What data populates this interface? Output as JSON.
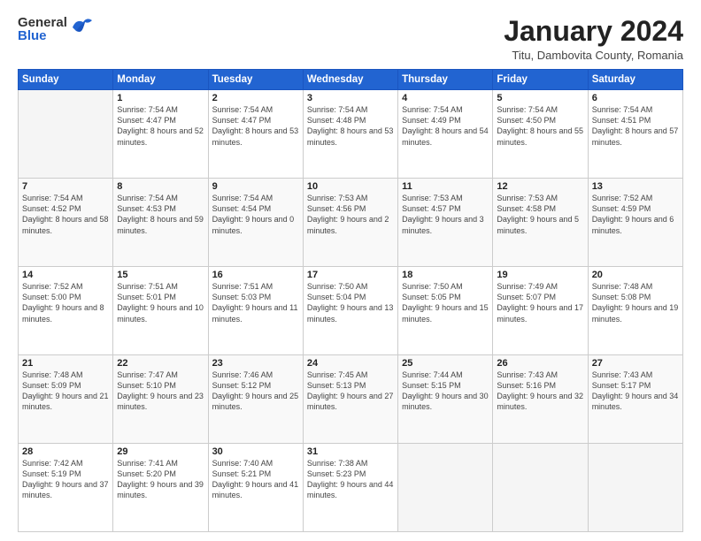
{
  "header": {
    "logo": {
      "general": "General",
      "blue": "Blue"
    },
    "title": "January 2024",
    "location": "Titu, Dambovita County, Romania"
  },
  "calendar": {
    "days": [
      "Sunday",
      "Monday",
      "Tuesday",
      "Wednesday",
      "Thursday",
      "Friday",
      "Saturday"
    ],
    "weeks": [
      [
        {
          "num": "",
          "empty": true
        },
        {
          "num": "1",
          "sunrise": "7:54 AM",
          "sunset": "4:47 PM",
          "daylight": "8 hours and 52 minutes."
        },
        {
          "num": "2",
          "sunrise": "7:54 AM",
          "sunset": "4:47 PM",
          "daylight": "8 hours and 53 minutes."
        },
        {
          "num": "3",
          "sunrise": "7:54 AM",
          "sunset": "4:48 PM",
          "daylight": "8 hours and 53 minutes."
        },
        {
          "num": "4",
          "sunrise": "7:54 AM",
          "sunset": "4:49 PM",
          "daylight": "8 hours and 54 minutes."
        },
        {
          "num": "5",
          "sunrise": "7:54 AM",
          "sunset": "4:50 PM",
          "daylight": "8 hours and 55 minutes."
        },
        {
          "num": "6",
          "sunrise": "7:54 AM",
          "sunset": "4:51 PM",
          "daylight": "8 hours and 57 minutes."
        }
      ],
      [
        {
          "num": "7",
          "sunrise": "7:54 AM",
          "sunset": "4:52 PM",
          "daylight": "8 hours and 58 minutes."
        },
        {
          "num": "8",
          "sunrise": "7:54 AM",
          "sunset": "4:53 PM",
          "daylight": "8 hours and 59 minutes."
        },
        {
          "num": "9",
          "sunrise": "7:54 AM",
          "sunset": "4:54 PM",
          "daylight": "9 hours and 0 minutes."
        },
        {
          "num": "10",
          "sunrise": "7:53 AM",
          "sunset": "4:56 PM",
          "daylight": "9 hours and 2 minutes."
        },
        {
          "num": "11",
          "sunrise": "7:53 AM",
          "sunset": "4:57 PM",
          "daylight": "9 hours and 3 minutes."
        },
        {
          "num": "12",
          "sunrise": "7:53 AM",
          "sunset": "4:58 PM",
          "daylight": "9 hours and 5 minutes."
        },
        {
          "num": "13",
          "sunrise": "7:52 AM",
          "sunset": "4:59 PM",
          "daylight": "9 hours and 6 minutes."
        }
      ],
      [
        {
          "num": "14",
          "sunrise": "7:52 AM",
          "sunset": "5:00 PM",
          "daylight": "9 hours and 8 minutes."
        },
        {
          "num": "15",
          "sunrise": "7:51 AM",
          "sunset": "5:01 PM",
          "daylight": "9 hours and 10 minutes."
        },
        {
          "num": "16",
          "sunrise": "7:51 AM",
          "sunset": "5:03 PM",
          "daylight": "9 hours and 11 minutes."
        },
        {
          "num": "17",
          "sunrise": "7:50 AM",
          "sunset": "5:04 PM",
          "daylight": "9 hours and 13 minutes."
        },
        {
          "num": "18",
          "sunrise": "7:50 AM",
          "sunset": "5:05 PM",
          "daylight": "9 hours and 15 minutes."
        },
        {
          "num": "19",
          "sunrise": "7:49 AM",
          "sunset": "5:07 PM",
          "daylight": "9 hours and 17 minutes."
        },
        {
          "num": "20",
          "sunrise": "7:48 AM",
          "sunset": "5:08 PM",
          "daylight": "9 hours and 19 minutes."
        }
      ],
      [
        {
          "num": "21",
          "sunrise": "7:48 AM",
          "sunset": "5:09 PM",
          "daylight": "9 hours and 21 minutes."
        },
        {
          "num": "22",
          "sunrise": "7:47 AM",
          "sunset": "5:10 PM",
          "daylight": "9 hours and 23 minutes."
        },
        {
          "num": "23",
          "sunrise": "7:46 AM",
          "sunset": "5:12 PM",
          "daylight": "9 hours and 25 minutes."
        },
        {
          "num": "24",
          "sunrise": "7:45 AM",
          "sunset": "5:13 PM",
          "daylight": "9 hours and 27 minutes."
        },
        {
          "num": "25",
          "sunrise": "7:44 AM",
          "sunset": "5:15 PM",
          "daylight": "9 hours and 30 minutes."
        },
        {
          "num": "26",
          "sunrise": "7:43 AM",
          "sunset": "5:16 PM",
          "daylight": "9 hours and 32 minutes."
        },
        {
          "num": "27",
          "sunrise": "7:43 AM",
          "sunset": "5:17 PM",
          "daylight": "9 hours and 34 minutes."
        }
      ],
      [
        {
          "num": "28",
          "sunrise": "7:42 AM",
          "sunset": "5:19 PM",
          "daylight": "9 hours and 37 minutes."
        },
        {
          "num": "29",
          "sunrise": "7:41 AM",
          "sunset": "5:20 PM",
          "daylight": "9 hours and 39 minutes."
        },
        {
          "num": "30",
          "sunrise": "7:40 AM",
          "sunset": "5:21 PM",
          "daylight": "9 hours and 41 minutes."
        },
        {
          "num": "31",
          "sunrise": "7:38 AM",
          "sunset": "5:23 PM",
          "daylight": "9 hours and 44 minutes."
        },
        {
          "num": "",
          "empty": true
        },
        {
          "num": "",
          "empty": true
        },
        {
          "num": "",
          "empty": true
        }
      ]
    ]
  }
}
